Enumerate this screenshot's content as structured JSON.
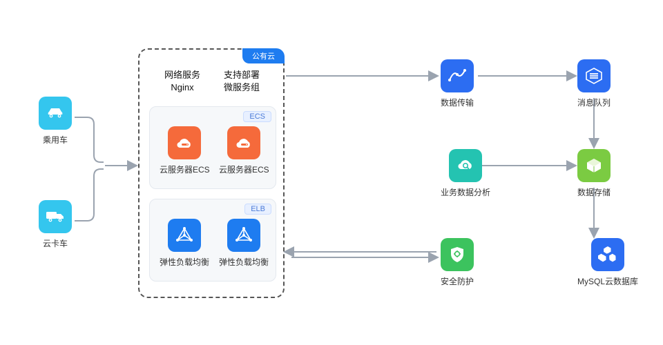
{
  "sources": {
    "car": {
      "label": "乘用车"
    },
    "truck": {
      "label": "云卡车"
    }
  },
  "center": {
    "tab": "公有云",
    "header_left_line1": "网络服务",
    "header_left_line2": "Nginx",
    "header_right_line1": "支持部署",
    "header_right_line2": "微服务组",
    "ecs": {
      "tag": "ECS",
      "item1": "云服务器ECS",
      "item2": "云服务器ECS"
    },
    "elb": {
      "tag": "ELB",
      "item1": "弹性负载均衡",
      "item2": "弹性负载均衡"
    }
  },
  "right": {
    "node1": {
      "label": "数据传输"
    },
    "node2": {
      "label": "消息队列"
    },
    "node3": {
      "label": "业务数据分析"
    },
    "node4": {
      "label": "数据存储"
    },
    "node5": {
      "label": "安全防护"
    },
    "node6": {
      "label": "MySQL云数据库"
    }
  }
}
